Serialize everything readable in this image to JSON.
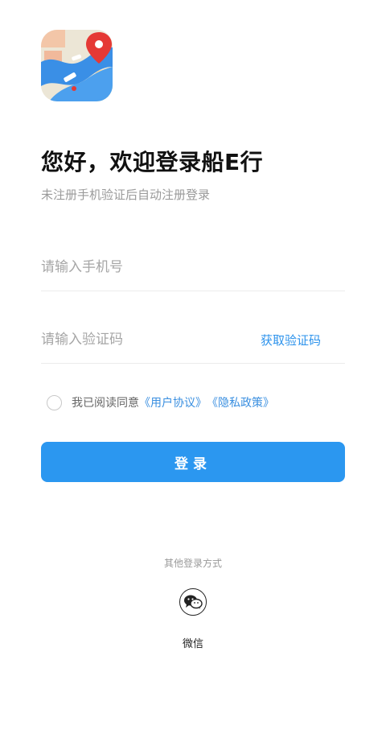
{
  "header": {
    "title": "您好，欢迎登录船E行",
    "subtitle": "未注册手机验证后自动注册登录"
  },
  "form": {
    "phone_placeholder": "请输入手机号",
    "code_placeholder": "请输入验证码",
    "get_code_label": "获取验证码"
  },
  "agreement": {
    "prefix": "我已阅读同意",
    "user_agreement": "《用户协议》",
    "privacy_policy": "《隐私政策》",
    "checked": false
  },
  "login_button": "登录",
  "other_login": {
    "label": "其他登录方式",
    "wechat_label": "微信",
    "wechat_icon": "wechat-icon"
  },
  "colors": {
    "accent": "#2b97f0",
    "link": "#3a8fe0",
    "placeholder": "#a6a6a6"
  }
}
